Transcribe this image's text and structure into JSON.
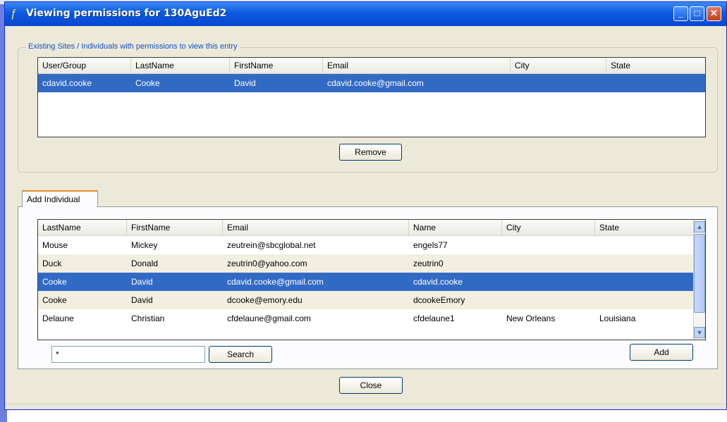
{
  "window": {
    "title": "Viewing permissions for 130AguEd2",
    "min_glyph": "_",
    "max_glyph": "□",
    "close_glyph": "✕"
  },
  "existing": {
    "group_label": "Existing Sites / Individuals with permissions to view this entry",
    "columns": [
      "User/Group",
      "LastName",
      "FirstName",
      "Email",
      "City",
      "State"
    ],
    "rows": [
      [
        "cdavid.cooke",
        "Cooke",
        "David",
        "cdavid.cooke@gmail.com",
        "",
        ""
      ]
    ],
    "remove_label": "Remove"
  },
  "add_tab": {
    "tab_label": "Add Individual",
    "columns": [
      "LastName",
      "FirstName",
      "Email",
      "Name",
      "City",
      "State"
    ],
    "rows": [
      [
        "Mouse",
        "Mickey",
        "zeutrein@sbcglobal.net",
        "engels77",
        "",
        ""
      ],
      [
        "Duck",
        "Donald",
        "zeutrin0@yahoo.com",
        "zeutrin0",
        "",
        ""
      ],
      [
        "Cooke",
        "David",
        "cdavid.cooke@gmail.com",
        "cdavid.cooke",
        "",
        ""
      ],
      [
        "Cooke",
        "David",
        "dcooke@emory.edu",
        "dcookeEmory",
        "",
        ""
      ],
      [
        "Delaune",
        "Christian",
        "cfdelaune@gmail.com",
        "cfdelaune1",
        "New Orleans",
        "Louisiana"
      ]
    ],
    "search_value": "*",
    "search_label": "Search",
    "add_label": "Add"
  },
  "close_label": "Close"
}
